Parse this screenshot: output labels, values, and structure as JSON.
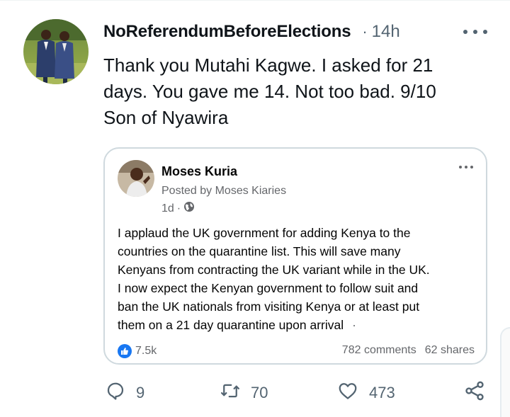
{
  "tweet": {
    "display_name": "NoReferendumBeforeElections",
    "separator": "·",
    "time": "14h",
    "avatar_icon": "profile-photo",
    "more_icon": "more-horizontal-icon",
    "text_lines": [
      "Thank you Mutahi Kagwe. I asked for 21",
      "days. You gave me 14. Not too bad. 9/10",
      "Son of Nyawira"
    ]
  },
  "embedded_post": {
    "author": "Moses Kuria",
    "posted_by": "Posted by Moses Kiaries",
    "time": "1d",
    "meta_dot": "·",
    "privacy_icon": "globe-icon",
    "body_lines": [
      "I applaud the UK government for adding Kenya to the",
      "countries on the quarantine list. This will save many",
      "Kenyans from contracting the UK variant while in the UK.",
      "I now expect the Kenyan government to follow suit and",
      "ban the UK nationals from visiting Kenya or at least put",
      "them on a 21 day quarantine upon arrival"
    ],
    "trailing_dot": "·",
    "likes": "7.5k",
    "comments": "782 comments",
    "shares": "62 shares",
    "accent_color": "#1877f2"
  },
  "actions": {
    "replies": "9",
    "retweets": "70",
    "likes": "473"
  },
  "colors": {
    "text": "#0f1419",
    "secondary": "#536471",
    "border": "#cfd9de"
  }
}
